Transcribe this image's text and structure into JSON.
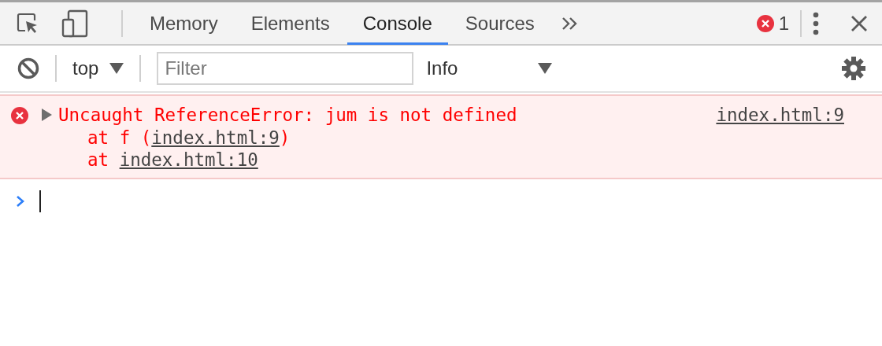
{
  "tabs": [
    {
      "label": "Memory",
      "selected": false
    },
    {
      "label": "Elements",
      "selected": false
    },
    {
      "label": "Console",
      "selected": true
    },
    {
      "label": "Sources",
      "selected": false
    }
  ],
  "error_count": "1",
  "toolbar": {
    "context": "top",
    "filter": {
      "placeholder": "Filter"
    },
    "level": "Info"
  },
  "messages": [
    {
      "kind": "error",
      "expanded": false,
      "text": "Uncaught ReferenceError: jum is not defined",
      "source": "index.html:9",
      "stack": [
        {
          "prefix": "at f (",
          "link": "index.html:9",
          "suffix": ")"
        },
        {
          "prefix": "at ",
          "link": "index.html:10"
        }
      ]
    }
  ]
}
